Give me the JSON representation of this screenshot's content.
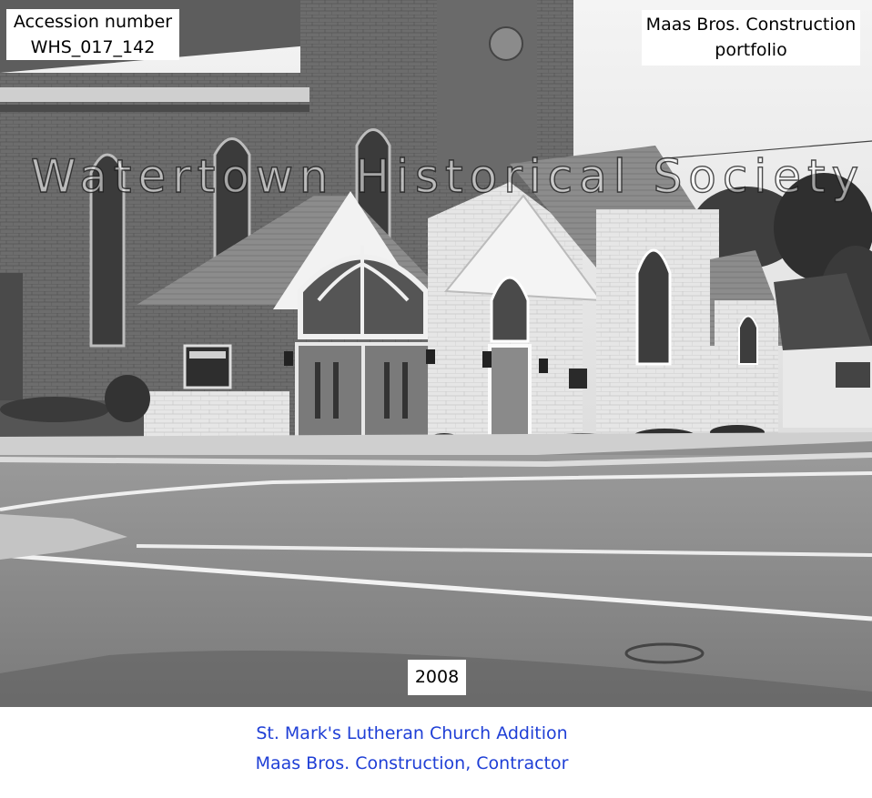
{
  "photo": {
    "accession_label": "Accession number",
    "accession_id": "WHS_017_142",
    "portfolio_line1": "Maas Bros. Construction",
    "portfolio_line2": "portfolio",
    "watermark": "Watertown Historical Society",
    "year": "2008"
  },
  "caption": {
    "title": "St. Mark's Lutheran Church Addition",
    "contractor": "Maas Bros. Construction, Contractor"
  },
  "colors": {
    "caption_text": "#1f3fd6",
    "label_box_bg": "#ffffff"
  }
}
